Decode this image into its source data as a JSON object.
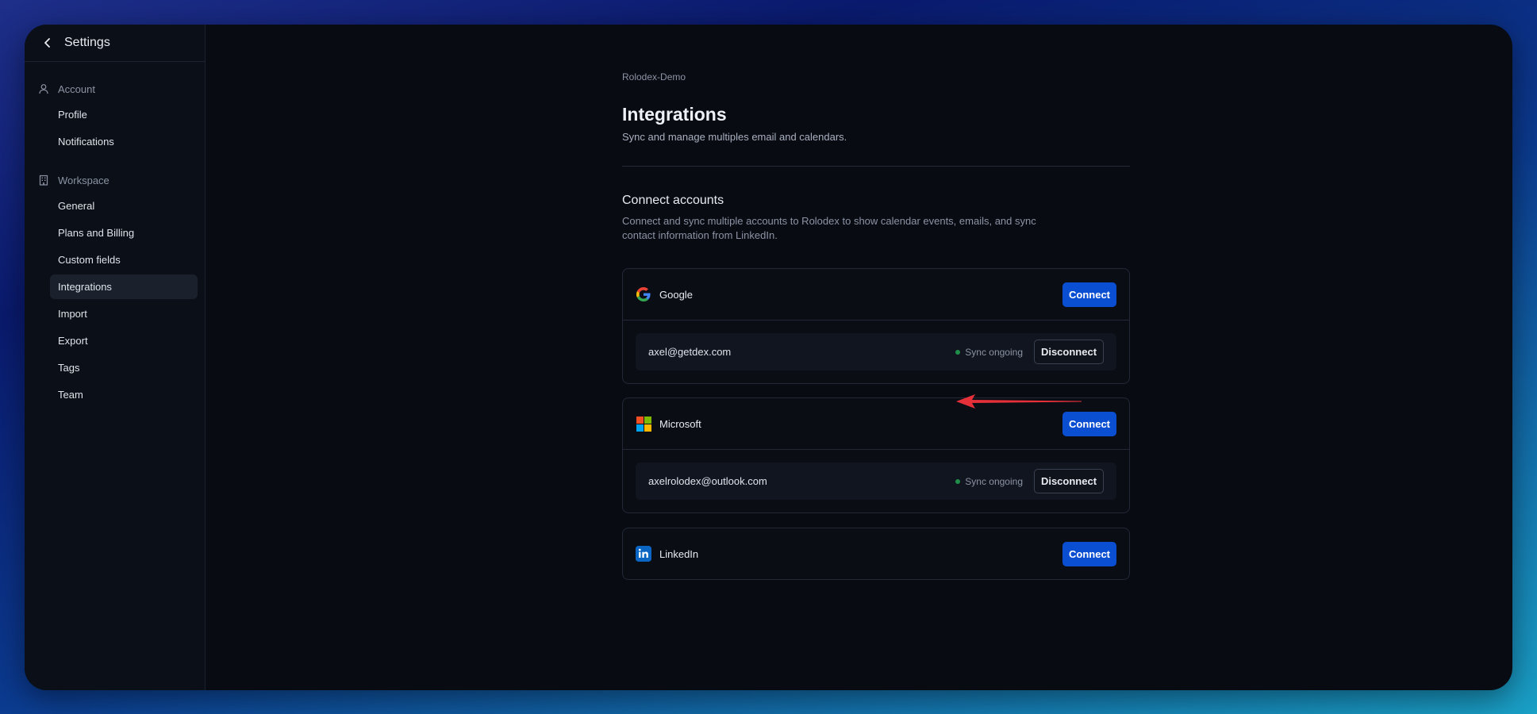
{
  "sidebar": {
    "title": "Settings",
    "sections": [
      {
        "label": "Account",
        "icon": "user-icon",
        "items": [
          "Profile",
          "Notifications"
        ]
      },
      {
        "label": "Workspace",
        "icon": "building-icon",
        "items": [
          "General",
          "Plans and Billing",
          "Custom fields",
          "Integrations",
          "Import",
          "Export",
          "Tags",
          "Team"
        ]
      }
    ],
    "active_item": "Integrations"
  },
  "main": {
    "breadcrumb": "Rolodex-Demo",
    "title": "Integrations",
    "subtitle": "Sync and manage multiples email and calendars.",
    "connect_title": "Connect accounts",
    "connect_desc": "Connect and sync multiple accounts to Rolodex to show calendar events, emails, and sync contact information from LinkedIn.",
    "providers": [
      {
        "name": "Google",
        "icon": "google-icon",
        "connect_label": "Connect",
        "account": {
          "email": "axel@getdex.com",
          "status": "Sync ongoing",
          "disconnect_label": "Disconnect"
        }
      },
      {
        "name": "Microsoft",
        "icon": "microsoft-icon",
        "connect_label": "Connect",
        "account": {
          "email": "axelrolodex@outlook.com",
          "status": "Sync ongoing",
          "disconnect_label": "Disconnect"
        }
      },
      {
        "name": "LinkedIn",
        "icon": "linkedin-icon",
        "connect_label": "Connect"
      }
    ]
  },
  "colors": {
    "accent": "#0a4ed1",
    "sync_ok": "#1f8f4a",
    "annotation_arrow": "#e5303a"
  }
}
